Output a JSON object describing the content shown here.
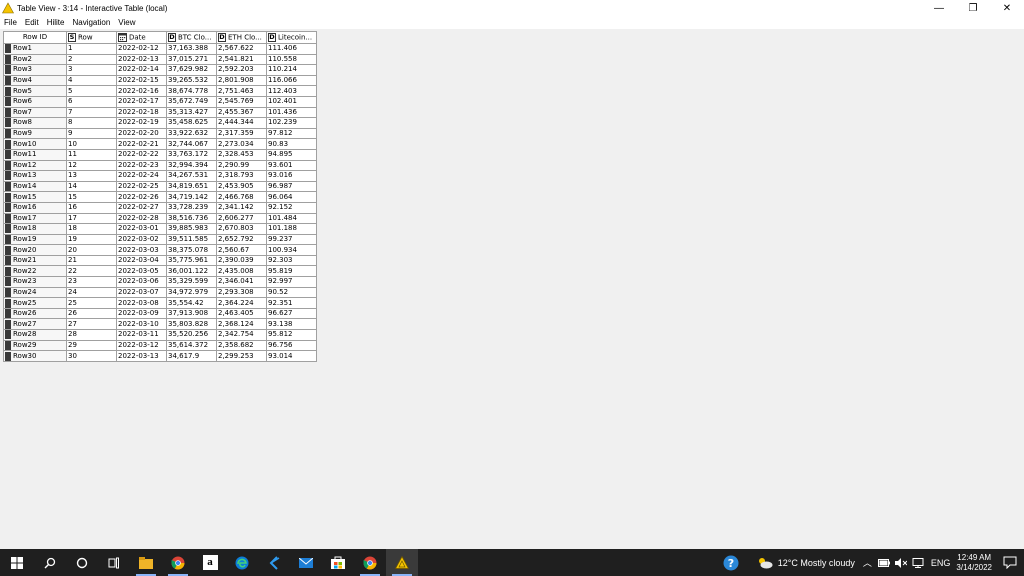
{
  "window": {
    "title": "Table View - 3:14 - Interactive Table (local)",
    "controls": {
      "minimize": "—",
      "maximize": "❐",
      "close": "✕"
    }
  },
  "menu": [
    "File",
    "Edit",
    "Hilite",
    "Navigation",
    "View"
  ],
  "table": {
    "columns": [
      {
        "label": "Row ID",
        "type": ""
      },
      {
        "label": "Row",
        "type": "S"
      },
      {
        "label": "Date",
        "type": "cal"
      },
      {
        "label": "BTC Clo...",
        "type": "D"
      },
      {
        "label": "ETH Clo...",
        "type": "D"
      },
      {
        "label": "Litecoin...",
        "type": "D"
      }
    ],
    "rows": [
      [
        "Row1",
        "1",
        "2022-02-12",
        "37,163.388",
        "2,567.622",
        "111.406"
      ],
      [
        "Row2",
        "2",
        "2022-02-13",
        "37,015.271",
        "2,541.821",
        "110.558"
      ],
      [
        "Row3",
        "3",
        "2022-02-14",
        "37,629.982",
        "2,592.203",
        "110.214"
      ],
      [
        "Row4",
        "4",
        "2022-02-15",
        "39,265.532",
        "2,801.908",
        "116.066"
      ],
      [
        "Row5",
        "5",
        "2022-02-16",
        "38,674.778",
        "2,751.463",
        "112.403"
      ],
      [
        "Row6",
        "6",
        "2022-02-17",
        "35,672.749",
        "2,545.769",
        "102.401"
      ],
      [
        "Row7",
        "7",
        "2022-02-18",
        "35,313.427",
        "2,455.367",
        "101.436"
      ],
      [
        "Row8",
        "8",
        "2022-02-19",
        "35,458.625",
        "2,444.344",
        "102.239"
      ],
      [
        "Row9",
        "9",
        "2022-02-20",
        "33,922.632",
        "2,317.359",
        "97.812"
      ],
      [
        "Row10",
        "10",
        "2022-02-21",
        "32,744.067",
        "2,273.034",
        "90.83"
      ],
      [
        "Row11",
        "11",
        "2022-02-22",
        "33,763.172",
        "2,328.453",
        "94.895"
      ],
      [
        "Row12",
        "12",
        "2022-02-23",
        "32,994.394",
        "2,290.99",
        "93.601"
      ],
      [
        "Row13",
        "13",
        "2022-02-24",
        "34,267.531",
        "2,318.793",
        "93.016"
      ],
      [
        "Row14",
        "14",
        "2022-02-25",
        "34,819.651",
        "2,453.905",
        "96.987"
      ],
      [
        "Row15",
        "15",
        "2022-02-26",
        "34,719.142",
        "2,466.768",
        "96.064"
      ],
      [
        "Row16",
        "16",
        "2022-02-27",
        "33,728.239",
        "2,341.142",
        "92.152"
      ],
      [
        "Row17",
        "17",
        "2022-02-28",
        "38,516.736",
        "2,606.277",
        "101.484"
      ],
      [
        "Row18",
        "18",
        "2022-03-01",
        "39,885.983",
        "2,670.803",
        "101.188"
      ],
      [
        "Row19",
        "19",
        "2022-03-02",
        "39,511.585",
        "2,652.792",
        "99.237"
      ],
      [
        "Row20",
        "20",
        "2022-03-03",
        "38,375.078",
        "2,560.67",
        "100.934"
      ],
      [
        "Row21",
        "21",
        "2022-03-04",
        "35,775.961",
        "2,390.039",
        "92.303"
      ],
      [
        "Row22",
        "22",
        "2022-03-05",
        "36,001.122",
        "2,435.008",
        "95.819"
      ],
      [
        "Row23",
        "23",
        "2022-03-06",
        "35,329.599",
        "2,346.041",
        "92.997"
      ],
      [
        "Row24",
        "24",
        "2022-03-07",
        "34,972.979",
        "2,293.308",
        "90.52"
      ],
      [
        "Row25",
        "25",
        "2022-03-08",
        "35,554.42",
        "2,364.224",
        "92.351"
      ],
      [
        "Row26",
        "26",
        "2022-03-09",
        "37,913.908",
        "2,463.405",
        "96.627"
      ],
      [
        "Row27",
        "27",
        "2022-03-10",
        "35,803.828",
        "2,368.124",
        "93.138"
      ],
      [
        "Row28",
        "28",
        "2022-03-11",
        "35,520.256",
        "2,342.754",
        "95.812"
      ],
      [
        "Row29",
        "29",
        "2022-03-12",
        "35,614.372",
        "2,358.682",
        "96.756"
      ],
      [
        "Row30",
        "30",
        "2022-03-13",
        "34,617.9",
        "2,299.253",
        "93.014"
      ]
    ]
  },
  "taskbar": {
    "icons": [
      "windows-icon",
      "search-icon",
      "cortana-icon",
      "task-view-icon",
      "file-explorer-icon",
      "chrome-icon",
      "amazon-icon",
      "edge-icon",
      "vscode-icon",
      "mail-icon",
      "store-icon",
      "chrome-profile-icon",
      "knime-icon"
    ],
    "weather": "12°C  Mostly cloudy",
    "language": "ENG",
    "time": "12:49 AM",
    "date": "3/14/2022"
  },
  "colors": {
    "accent_warning": "#f5c400",
    "taskbar_bg": "#1f1f1f",
    "row_marker": "#3a3a3a"
  }
}
